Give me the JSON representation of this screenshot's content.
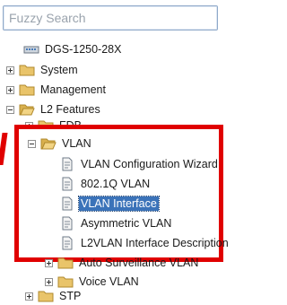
{
  "search": {
    "placeholder": "Fuzzy Search"
  },
  "tree": {
    "root": "DGS-1250-28X",
    "system": "System",
    "management": "Management",
    "l2": "L2 Features",
    "fdb": "FDB",
    "vlan": "VLAN",
    "vlan_wizard": "VLAN Configuration Wizard",
    "vlan_8021q": "802.1Q VLAN",
    "vlan_interface": "VLAN Interface",
    "asym_vlan": "Asymmetric VLAN",
    "l2vlan_desc": "L2VLAN Interface Description",
    "auto_surv": "Auto Surveillance VLAN",
    "voice_vlan": "Voice VLAN",
    "stp": "STP"
  },
  "annotation": {
    "highlight_color": "#e00000"
  },
  "colors": {
    "selection": "#3b73b9",
    "folder": "#e9c46a"
  }
}
